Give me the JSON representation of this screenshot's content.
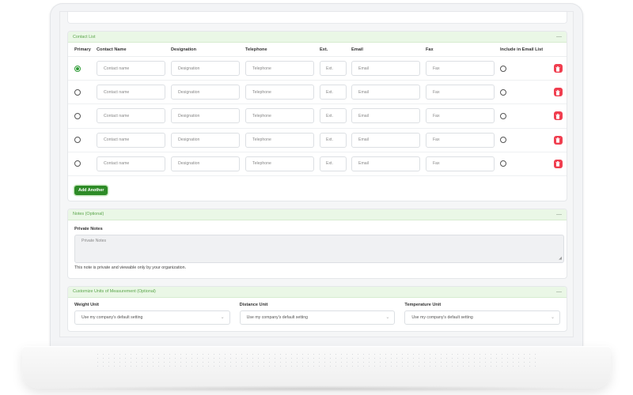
{
  "contact_list": {
    "title": "Contact List",
    "collapse": "—",
    "headers": {
      "primary": "Primary",
      "contact_name": "Contact Name",
      "designation": "Designation",
      "telephone": "Telephone",
      "ext": "Ext.",
      "email": "Email",
      "fax": "Fax",
      "include": "Include in Email List"
    },
    "placeholders": {
      "contact_name": "Contact name",
      "designation": "Designation",
      "telephone": "Telephone",
      "ext": "Ext.",
      "email": "Email",
      "fax": "Fax"
    },
    "rows": [
      {
        "primary": true
      },
      {
        "primary": false
      },
      {
        "primary": false
      },
      {
        "primary": false
      },
      {
        "primary": false
      }
    ],
    "add_label": "Add Another"
  },
  "notes": {
    "title": "Notes (Optional)",
    "collapse": "—",
    "label": "Private Notes",
    "placeholder": "Private Notes",
    "hint": "This note is private and viewable only by your organization."
  },
  "units": {
    "title": "Customize Units of Measurement (Optional)",
    "collapse": "—",
    "fields": [
      {
        "label": "Weight Unit",
        "value": "Use my company's default setting"
      },
      {
        "label": "Distance Unit",
        "value": "Use my company's default setting"
      },
      {
        "label": "Temperature Unit",
        "value": "Use my company's default setting"
      }
    ]
  },
  "colors": {
    "accent": "#2e8b27",
    "section_header_bg": "#eaf7e6",
    "delete": "#f03e4f"
  }
}
